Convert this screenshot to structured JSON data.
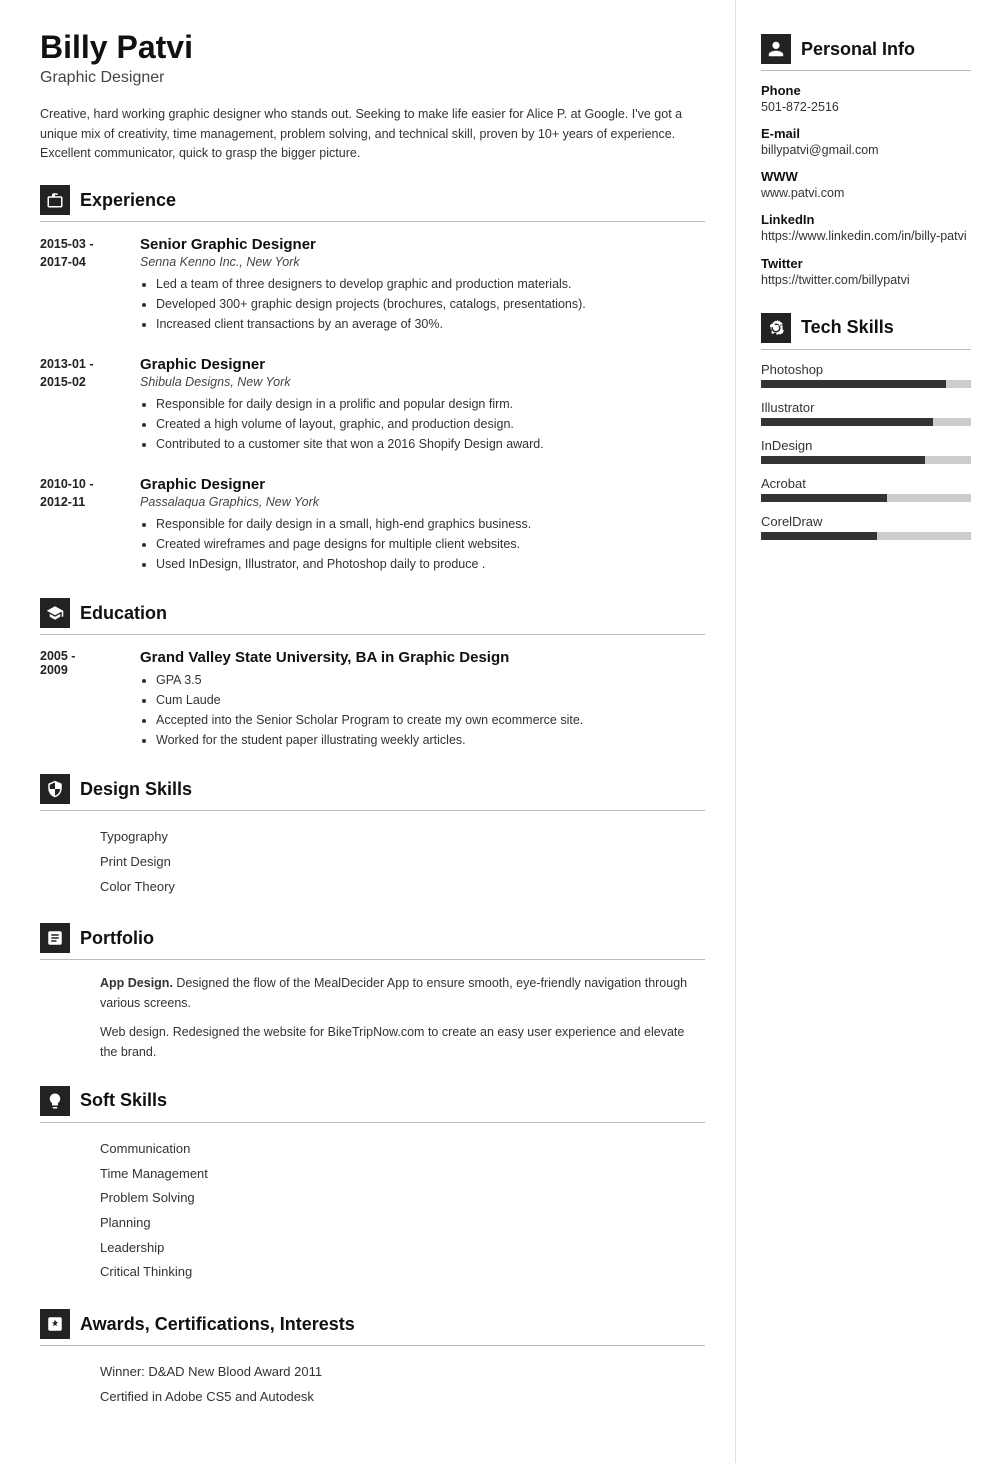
{
  "header": {
    "name": "Billy Patvi",
    "title": "Graphic Designer"
  },
  "summary": "Creative, hard working graphic designer who stands out. Seeking to make life easier for Alice P. at Google. I've got a unique mix of creativity, time management, problem solving, and technical skill, proven by 10+ years of experience. Excellent communicator, quick to grasp the bigger picture.",
  "experience": {
    "section_label": "Experience",
    "entries": [
      {
        "dates": "2015-03 -\n2017-04",
        "title": "Senior Graphic Designer",
        "company": "Senna Kenno Inc., New York",
        "bullets": [
          "Led a team of three designers to develop graphic and production materials.",
          "Developed 300+ graphic design projects (brochures, catalogs, presentations).",
          "Increased client transactions by an average of 30%."
        ]
      },
      {
        "dates": "2013-01 -\n2015-02",
        "title": "Graphic Designer",
        "company": "Shibula Designs, New York",
        "bullets": [
          "Responsible for daily design in a prolific and popular design firm.",
          "Created a high volume of layout, graphic, and production design.",
          "Contributed to a customer site that won a 2016 Shopify Design award."
        ]
      },
      {
        "dates": "2010-10 -\n2012-11",
        "title": "Graphic Designer",
        "company": "Passalaqua Graphics, New York",
        "bullets": [
          "Responsible for daily design in a small, high-end graphics business.",
          "Created wireframes and page designs for multiple client websites.",
          "Used InDesign, Illustrator, and Photoshop daily to produce ."
        ]
      }
    ]
  },
  "education": {
    "section_label": "Education",
    "entries": [
      {
        "dates": "2005 -\n2009",
        "institution": "Grand Valley State University, BA in Graphic Design",
        "bullets": [
          "GPA 3.5",
          "Cum Laude",
          "Accepted into the Senior Scholar Program to create my own ecommerce site.",
          "Worked for the student paper illustrating weekly articles."
        ]
      }
    ]
  },
  "design_skills": {
    "section_label": "Design Skills",
    "items": [
      "Typography",
      "Print Design",
      "Color Theory"
    ]
  },
  "portfolio": {
    "section_label": "Portfolio",
    "items": [
      {
        "bold": "App Design.",
        "text": " Designed the flow of the MealDecider App to ensure smooth, eye-friendly navigation through various screens."
      },
      {
        "bold": "",
        "text": "Web design. Redesigned the website for BikeTripNow.com to create an easy user experience and elevate the brand."
      }
    ]
  },
  "soft_skills": {
    "section_label": "Soft Skills",
    "items": [
      "Communication",
      "Time Management",
      "Problem Solving",
      "Planning",
      "Leadership",
      "Critical Thinking"
    ]
  },
  "awards": {
    "section_label": "Awards, Certifications, Interests",
    "items": [
      "Winner: D&AD New Blood Award 2011",
      "Certified in Adobe CS5 and Autodesk"
    ]
  },
  "personal_info": {
    "section_label": "Personal Info",
    "fields": [
      {
        "label": "Phone",
        "value": "501-872-2516"
      },
      {
        "label": "E-mail",
        "value": "billypatvi@gmail.com"
      },
      {
        "label": "WWW",
        "value": "www.patvi.com"
      },
      {
        "label": "LinkedIn",
        "value": "https://www.linkedin.com/in/billy-patvi"
      },
      {
        "label": "Twitter",
        "value": "https://twitter.com/billypatvi"
      }
    ]
  },
  "tech_skills": {
    "section_label": "Tech Skills",
    "items": [
      {
        "name": "Photoshop",
        "pct": 88
      },
      {
        "name": "Illustrator",
        "pct": 82
      },
      {
        "name": "InDesign",
        "pct": 78
      },
      {
        "name": "Acrobat",
        "pct": 60
      },
      {
        "name": "CorelDraw",
        "pct": 55
      }
    ]
  }
}
